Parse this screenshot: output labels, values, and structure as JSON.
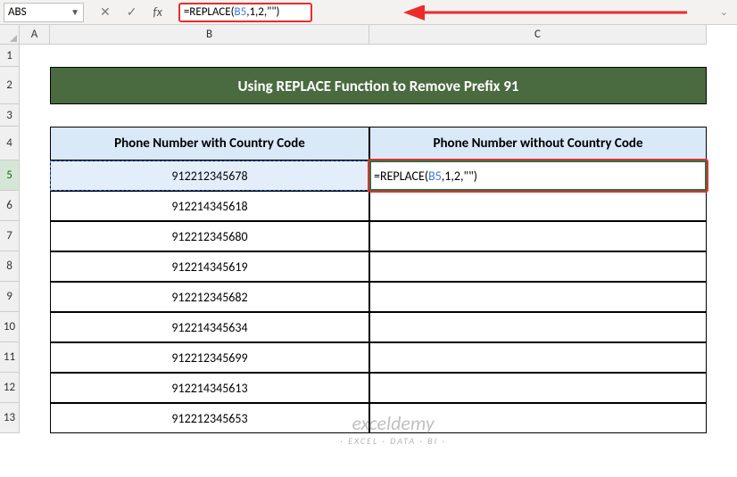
{
  "nameBox": {
    "value": "ABS"
  },
  "formulaBar": {
    "cancelGlyph": "✕",
    "enterGlyph": "✓",
    "fxLabel": "fx",
    "formulaPrefix": "=REPLACE(",
    "formulaRef": "B5",
    "formulaSuffix": ",1,2,\"\")"
  },
  "columns": {
    "A": "A",
    "B": "B",
    "C": "C"
  },
  "rowLabels": [
    "1",
    "2",
    "3",
    "4",
    "5",
    "6",
    "7",
    "8",
    "9",
    "10",
    "11",
    "12",
    "13"
  ],
  "title": "Using REPLACE Function to Remove Prefix 91",
  "headers": {
    "B": "Phone Number with Country Code",
    "C": "Phone Number without Country Code"
  },
  "phoneData": [
    "912212345678",
    "912214345618",
    "912212345680",
    "912214345619",
    "912212345682",
    "912214345634",
    "912212345699",
    "912214345613",
    "912212345653"
  ],
  "c5Display": {
    "prefix": "=REPLACE(",
    "ref": "B5",
    "suffix": ",1,2,\"\")"
  },
  "watermark": {
    "line1": "exceldemy",
    "line2": "· EXCEL · DATA · BI ·"
  }
}
